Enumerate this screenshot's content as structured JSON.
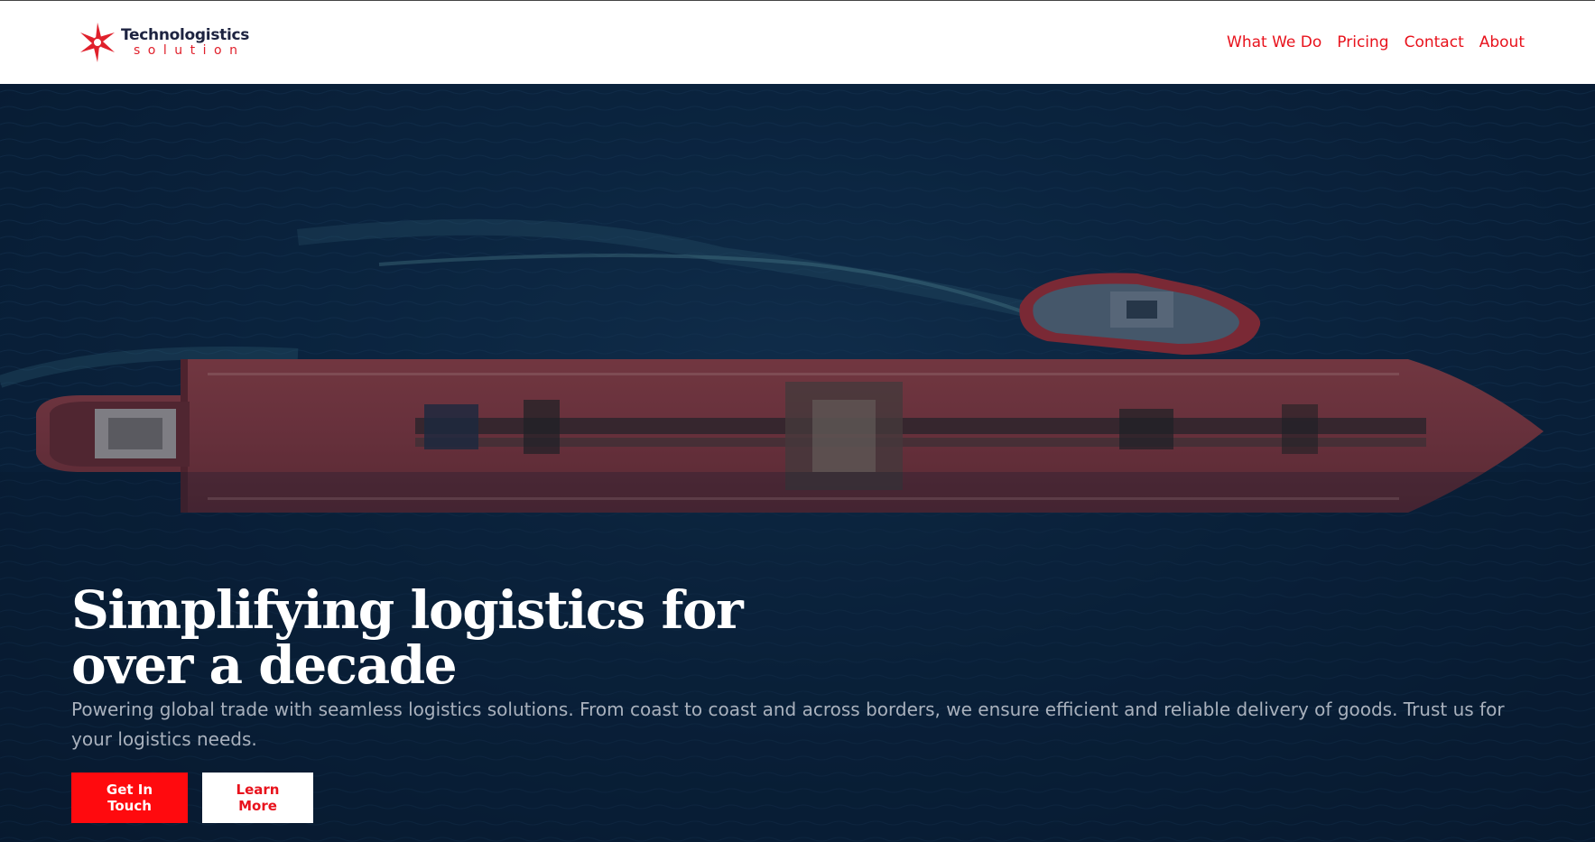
{
  "brand": {
    "name": "Technologistics",
    "tagline": "solution",
    "icon": "spiral-star-logo-icon",
    "colors": {
      "primary": "#e8121c",
      "dark": "#1d2340"
    }
  },
  "nav": {
    "items": [
      {
        "label": "What We Do"
      },
      {
        "label": "Pricing"
      },
      {
        "label": "Contact"
      },
      {
        "label": "About"
      }
    ]
  },
  "hero": {
    "image": "aerial-tanker-ship-with-tugboat",
    "title": "Simplifying logistics for over a decade",
    "subtitle": "Powering global trade with seamless logistics solutions. From coast to coast and across borders, we ensure efficient and reliable delivery of goods. Trust us for your logistics needs.",
    "primary_button": "Get In Touch",
    "secondary_button": "Learn More",
    "colors": {
      "button_primary": "#ff0a0e",
      "overlay": "#0b2540"
    }
  }
}
